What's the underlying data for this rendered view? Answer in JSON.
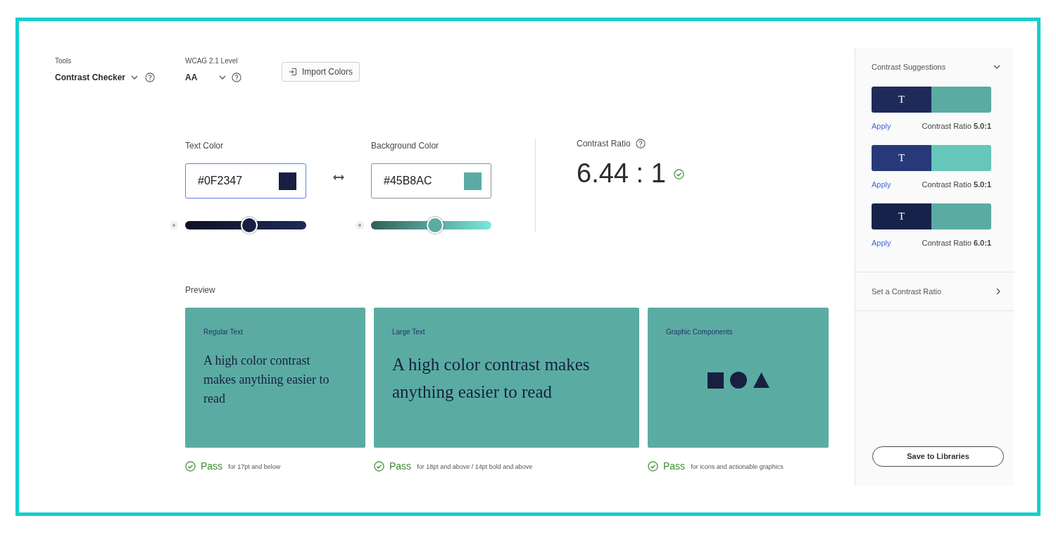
{
  "toolbar": {
    "dropdowns": [
      {
        "label": "Tools",
        "value": "Contrast Checker"
      },
      {
        "label": "WCAG 2.1 Level",
        "value": "AA"
      }
    ],
    "import_button": "Import Colors"
  },
  "color_fields": [
    {
      "label": "Text Color",
      "value": "#0F2347",
      "color": "#172041",
      "focused": true,
      "level": 0.53
    },
    {
      "label": "Background Color",
      "value": "#45B8AC",
      "color": "#5aaca2",
      "focused": false,
      "level": 0.53
    }
  ],
  "contrast_ratio": {
    "label": "Contrast Ratio",
    "value": "6.44 : 1",
    "passed": true
  },
  "preview": {
    "label": "Preview",
    "cards": [
      {
        "kind": "regular_text",
        "title": "Regular Text",
        "sample": "A high color contrast makes anything easier to read",
        "status": {
          "label": "Pass",
          "note": "for 17pt and below",
          "passed": true
        }
      },
      {
        "kind": "large_text",
        "title": "Large Text",
        "sample": "A high color contrast makes anything easier to read",
        "status": {
          "label": "Pass",
          "note": "for 18pt and above / 14pt bold and above",
          "passed": true
        }
      },
      {
        "kind": "graphic",
        "title": "Graphic Components",
        "status": {
          "label": "Pass",
          "note": "for icons and actionable graphics",
          "passed": true
        }
      }
    ]
  },
  "sidebar": {
    "sections": [
      {
        "title": "Contrast Suggestions",
        "expanded": true,
        "suggestions": [
          {
            "swatches": [
              {
                "sample": "T",
                "color": "#1e2a5a"
              },
              {
                "color": "#5aaba2"
              }
            ],
            "action": "Apply",
            "ratio": "Contrast Ratio **5.0:1**"
          },
          {
            "swatches": [
              {
                "sample": "T",
                "color": "#27397a"
              },
              {
                "color": "#66c6ba"
              }
            ],
            "action": "Apply",
            "ratio": "Contrast Ratio **5.0:1**"
          },
          {
            "swatches": [
              {
                "sample": "T",
                "color": "#17224a"
              },
              {
                "color": "#5aaca2"
              }
            ],
            "action": "Apply",
            "ratio": "Contrast Ratio **6.0:1**"
          }
        ]
      },
      {
        "title": "Set a Contrast Ratio",
        "expanded": false
      }
    ],
    "save_button": "Save to Libraries"
  }
}
